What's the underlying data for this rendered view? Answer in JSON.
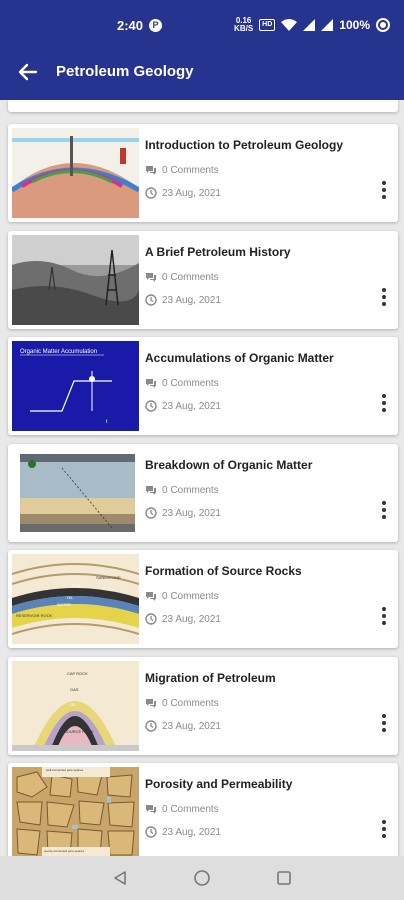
{
  "status_bar": {
    "time": "2:40",
    "p_icon": "P",
    "speed_value": "0.16",
    "speed_unit": "KB/S",
    "hd_label": "HD",
    "battery": "100%"
  },
  "app_bar": {
    "title": "Petroleum Geology",
    "back_icon": "arrow-left-icon"
  },
  "articles": [
    {
      "title": "Introduction to Petroleum Geology",
      "comments": "0 Comments",
      "date": "23 Aug, 2021"
    },
    {
      "title": "A Brief Petroleum History",
      "comments": "0 Comments",
      "date": "23 Aug, 2021"
    },
    {
      "title": "Accumulations of Organic Matter",
      "comments": "0 Comments",
      "date": "23 Aug, 2021",
      "thumb_heading": "Organic Matter Accumulation"
    },
    {
      "title": "Breakdown of Organic Matter",
      "comments": "0 Comments",
      "date": "23 Aug, 2021"
    },
    {
      "title": "Formation of Source Rocks",
      "comments": "0 Comments",
      "date": "23 Aug, 2021",
      "thumb_labels": [
        "GAS",
        "OIL",
        "WATER",
        "RESERVOIR ROCK",
        "SANDSTONE"
      ]
    },
    {
      "title": "Migration of Petroleum",
      "comments": "0 Comments",
      "date": "23 Aug, 2021",
      "thumb_labels": [
        "CAP ROCK",
        "GAS",
        "OIL",
        "SOURCE ROCK"
      ]
    },
    {
      "title": "Porosity and Permeability",
      "comments": "0 Comments",
      "date": "23 Aug, 2021",
      "thumb_labels": [
        "well-connected pore spaces",
        "poorly-connected pore spaces"
      ]
    }
  ],
  "colors": {
    "app_bar": "#26348f",
    "background": "#e9e9e9",
    "card": "#ffffff",
    "meta_text": "#8a8a8a"
  },
  "nav": [
    "back-triangle-icon",
    "home-circle-icon",
    "recents-square-icon"
  ]
}
